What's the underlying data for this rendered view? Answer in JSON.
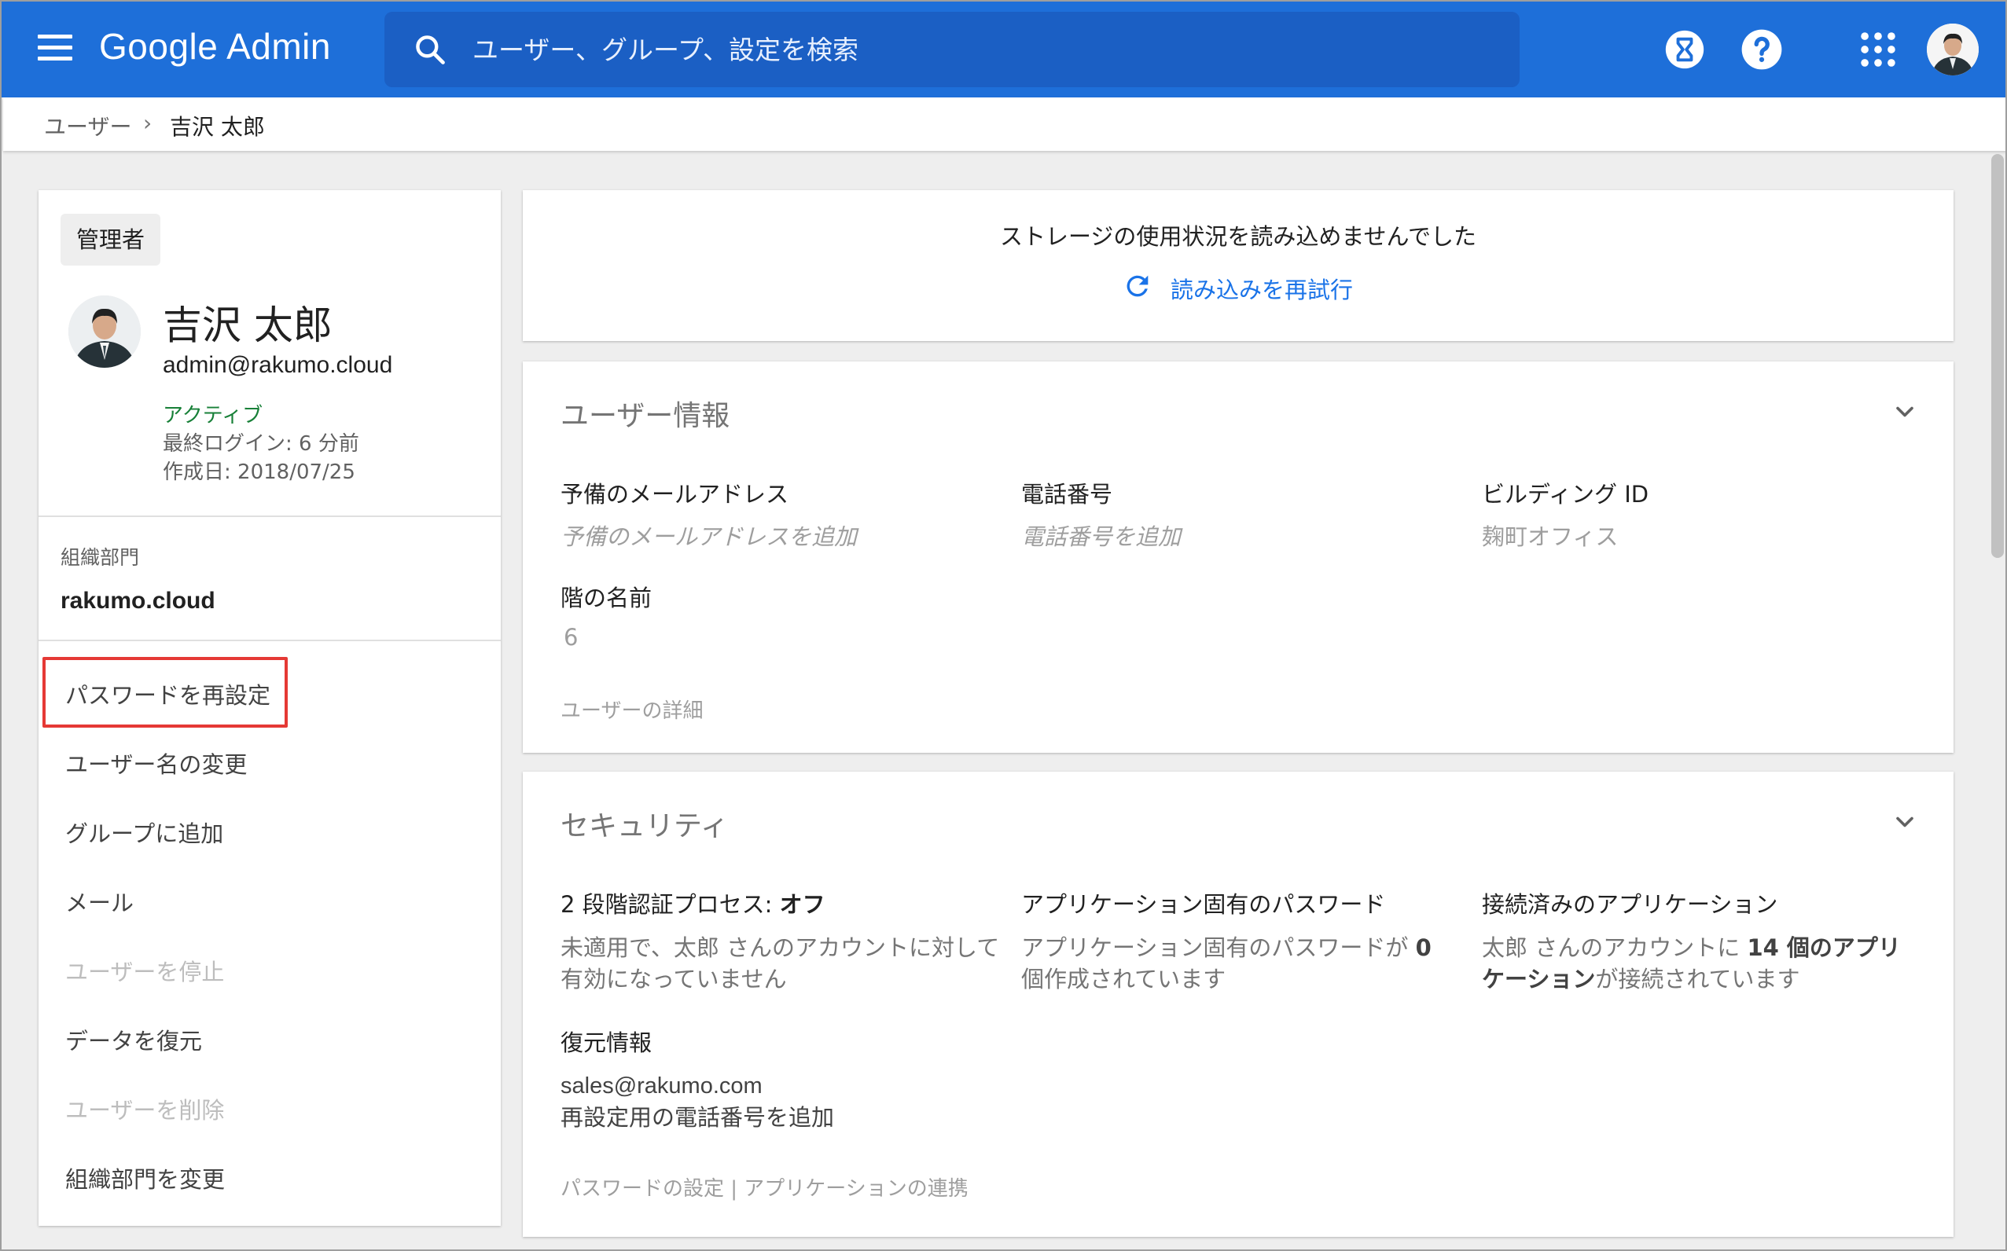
{
  "topbar": {
    "brand": "Google Admin",
    "search_placeholder": "ユーザー、グループ、設定を検索",
    "icons": [
      "menu-icon",
      "search-icon",
      "hourglass-icon",
      "help-icon",
      "apps-grid-icon",
      "account-avatar"
    ]
  },
  "breadcrumb": {
    "parent": "ユーザー",
    "separator": "›",
    "current": "吉沢 太郎"
  },
  "profile": {
    "role": "管理者",
    "name": "吉沢 太郎",
    "email": "admin@rakumo.cloud",
    "status": "アクティブ",
    "last_login": "最終ログイン: 6 分前",
    "created": "作成日: 2018/07/25",
    "org_label": "組織部門",
    "org_value": "rakumo.cloud"
  },
  "actions": [
    {
      "label": "パスワードを再設定",
      "enabled": true
    },
    {
      "label": "ユーザー名の変更",
      "enabled": true
    },
    {
      "label": "グループに追加",
      "enabled": true
    },
    {
      "label": "メール",
      "enabled": true
    },
    {
      "label": "ユーザーを停止",
      "enabled": false
    },
    {
      "label": "データを復元",
      "enabled": true
    },
    {
      "label": "ユーザーを削除",
      "enabled": false
    },
    {
      "label": "組織部門を変更",
      "enabled": true
    }
  ],
  "storage": {
    "message": "ストレージの使用状況を読み込めませんでした",
    "retry": "読み込みを再試行"
  },
  "user_info": {
    "title": "ユーザー情報",
    "fields": [
      {
        "label": "予備のメールアドレス",
        "value": "予備のメールアドレスを追加"
      },
      {
        "label": "電話番号",
        "value": "電話番号を追加"
      },
      {
        "label": "ビルディング ID",
        "value": "麹町オフィス"
      },
      {
        "label": "階の名前",
        "value": "6"
      }
    ],
    "details_link": "ユーザーの詳細"
  },
  "security": {
    "title": "セキュリティ",
    "two_step": {
      "label": "2 段階認証プロセス: ",
      "value": "オフ",
      "desc": "未適用で、太郎 さんのアカウントに対して有効になっていません"
    },
    "app_passwords": {
      "label": "アプリケーション固有のパスワード",
      "desc_pre": "アプリケーション固有のパスワードが ",
      "count": "0",
      "desc_post": " 個作成されています"
    },
    "connected_apps": {
      "label": "接続済みのアプリケーション",
      "desc_pre": "太郎 さんのアカウントに ",
      "count_text": "14 個のアプリケーション",
      "desc_post": "が接続されています"
    },
    "recovery": {
      "label": "復元情報",
      "email": "sales@rakumo.com",
      "phone": "再設定用の電話番号を追加"
    },
    "links": "パスワードの設定 | アプリケーションの連携"
  },
  "colors": {
    "topbar": "#1e6fd9",
    "search": "#1b5fc4",
    "accent_link": "#1a73e8",
    "active_status": "#188038",
    "highlight": "#e53935"
  }
}
